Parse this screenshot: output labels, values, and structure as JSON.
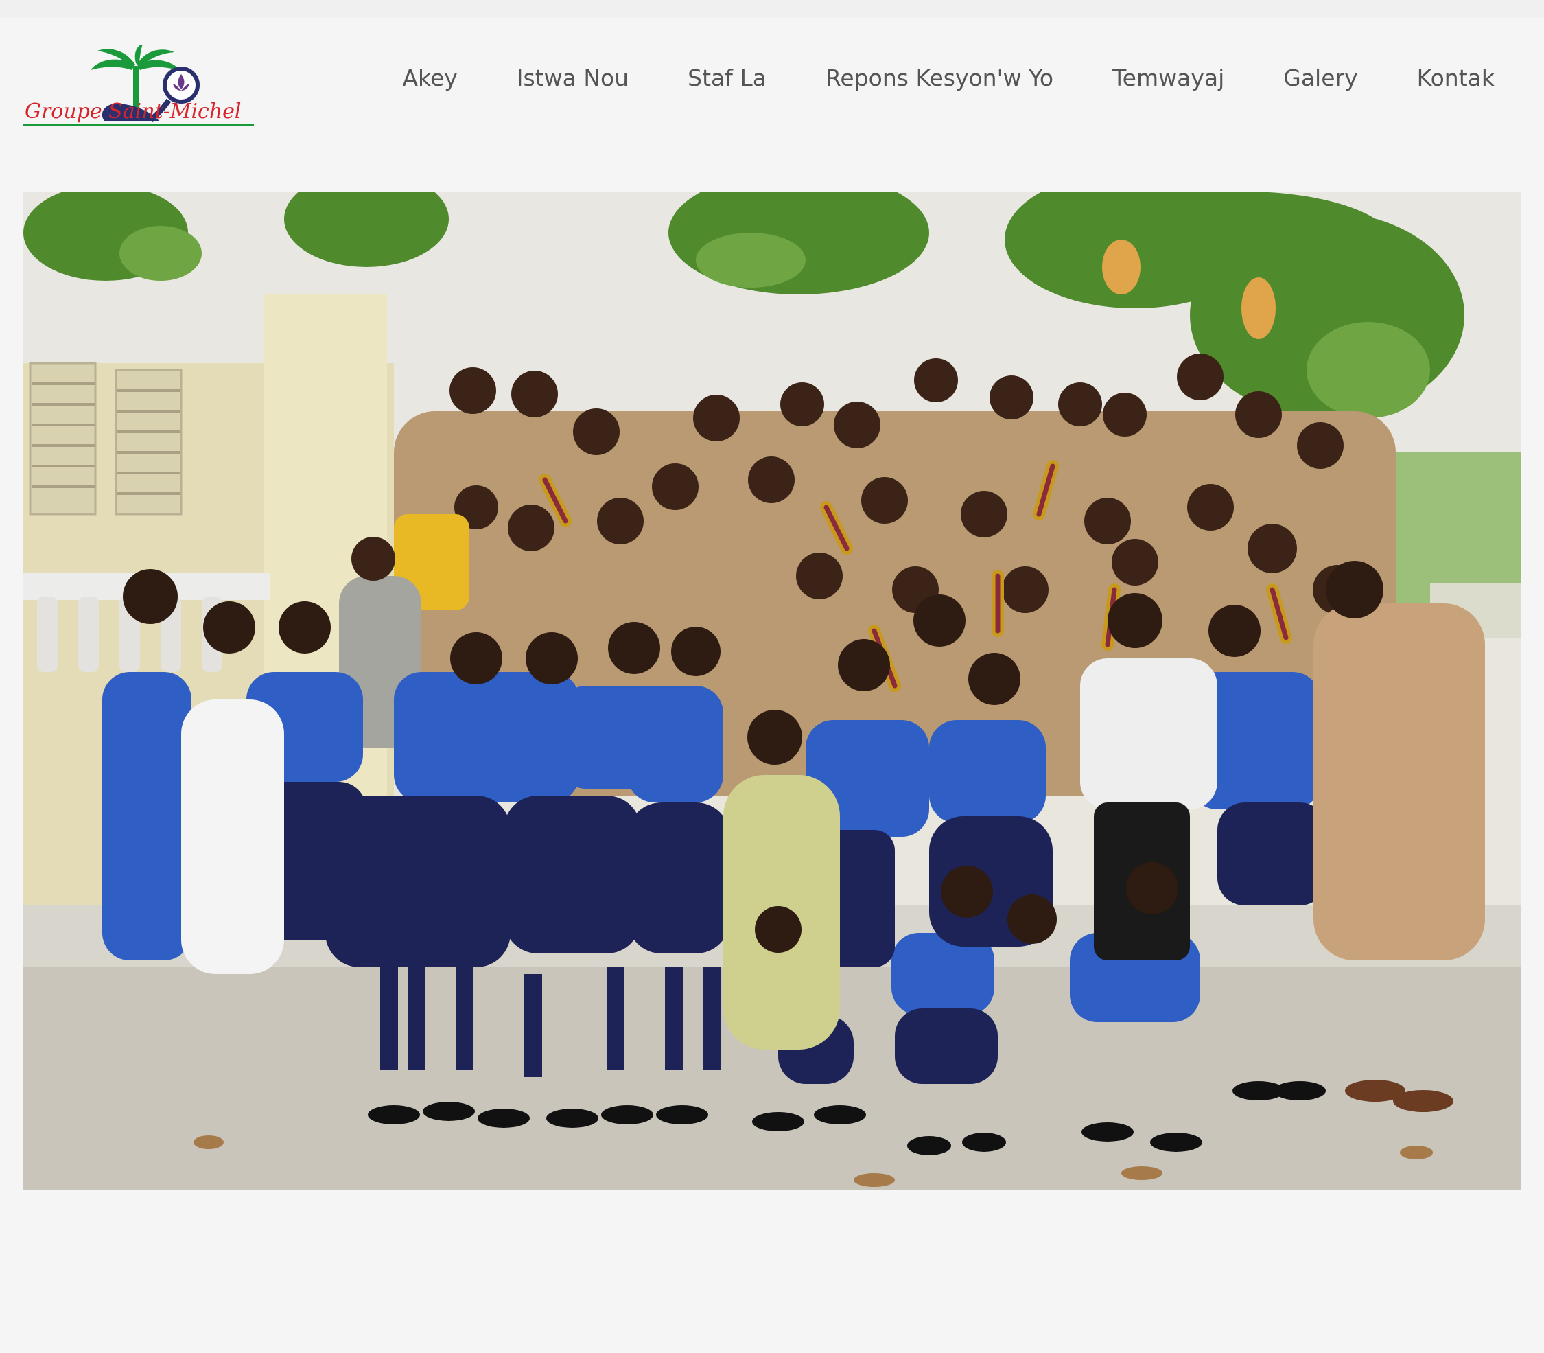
{
  "logo": {
    "text": "Groupe Saint-Michel",
    "icon": "palm-tree-fleur-de-lis-logo"
  },
  "nav": {
    "items": [
      {
        "label": "Akey"
      },
      {
        "label": "Istwa Nou"
      },
      {
        "label": "Staf La"
      },
      {
        "label": "Repons Kesyon'w Yo"
      },
      {
        "label": "Temwayaj"
      },
      {
        "label": "Galery"
      },
      {
        "label": "Kontak"
      }
    ]
  },
  "hero": {
    "icon": "group-photo-scouts"
  },
  "colors": {
    "background": "#f5f5f5",
    "nav_text": "#555555",
    "logo_red": "#d8232a",
    "logo_navy": "#2a2f6e",
    "logo_green": "#1a9a3a"
  }
}
